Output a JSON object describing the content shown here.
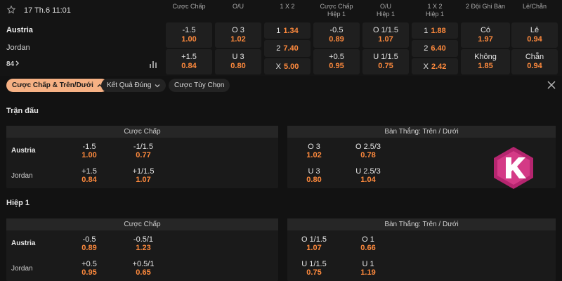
{
  "match": {
    "datetime": "17 Th.6 11:01",
    "team_home": "Austria",
    "team_away": "Jordan",
    "more_markets": "84"
  },
  "columns": [
    {
      "line1": "Cược Chấp",
      "line2": ""
    },
    {
      "line1": "O/U",
      "line2": ""
    },
    {
      "line1": "1 X 2",
      "line2": ""
    },
    {
      "line1": "Cược Chấp",
      "line2": "Hiệp 1"
    },
    {
      "line1": "O/U",
      "line2": "Hiệp 1"
    },
    {
      "line1": "1 X 2",
      "line2": "Hiệp 1"
    },
    {
      "line1": "2 Đội Ghi Bàn",
      "line2": ""
    },
    {
      "line1": "Lẻ/Chẵn",
      "line2": ""
    }
  ],
  "top_odds": {
    "handicap": [
      {
        "label": "-1.5",
        "value": "1.00"
      },
      {
        "label": "+1.5",
        "value": "0.84"
      }
    ],
    "ou": [
      {
        "label": "O 3",
        "value": "1.02"
      },
      {
        "label": "U 3",
        "value": "0.80"
      }
    ],
    "x12": [
      {
        "label": "1",
        "value": "1.34"
      },
      {
        "label": "2",
        "value": "7.40"
      },
      {
        "label": "X",
        "value": "5.00"
      }
    ],
    "handicap_h1": [
      {
        "label": "-0.5",
        "value": "0.89"
      },
      {
        "label": "+0.5",
        "value": "0.95"
      }
    ],
    "ou_h1": [
      {
        "label": "O 1/1.5",
        "value": "1.07"
      },
      {
        "label": "U 1/1.5",
        "value": "0.75"
      }
    ],
    "x12_h1": [
      {
        "label": "1",
        "value": "1.88"
      },
      {
        "label": "2",
        "value": "6.40"
      },
      {
        "label": "X",
        "value": "2.42"
      }
    ],
    "btts": [
      {
        "label": "Có",
        "value": "1.97"
      },
      {
        "label": "Không",
        "value": "1.85"
      }
    ],
    "oddeven": [
      {
        "label": "Lẻ",
        "value": "0.94"
      },
      {
        "label": "Chẵn",
        "value": "0.94"
      }
    ]
  },
  "tabs": [
    {
      "label": "Cược Chấp & Trên/Dưới",
      "active": true
    },
    {
      "label": "Kết Quả Đúng",
      "active": false
    },
    {
      "label": "Cược Tùy Chọn",
      "active": false
    }
  ],
  "sections": [
    {
      "title": "Trận đấu",
      "handicap_panel": {
        "title": "Cược Chấp",
        "home": "Austria",
        "away": "Jordan",
        "home_odds": [
          {
            "label": "-1.5",
            "value": "1.00"
          },
          {
            "label": "-1/1.5",
            "value": "0.77"
          }
        ],
        "away_odds": [
          {
            "label": "+1.5",
            "value": "0.84"
          },
          {
            "label": "+1/1.5",
            "value": "1.07"
          }
        ]
      },
      "ou_panel": {
        "title": "Bàn Thắng: Trên / Dưới",
        "over_odds": [
          {
            "label": "O 3",
            "value": "1.02"
          },
          {
            "label": "O 2.5/3",
            "value": "0.78"
          }
        ],
        "under_odds": [
          {
            "label": "U 3",
            "value": "0.80"
          },
          {
            "label": "U 2.5/3",
            "value": "1.04"
          }
        ]
      }
    },
    {
      "title": "Hiệp 1",
      "handicap_panel": {
        "title": "Cược Chấp",
        "home": "Austria",
        "away": "Jordan",
        "home_odds": [
          {
            "label": "-0.5",
            "value": "0.89"
          },
          {
            "label": "-0.5/1",
            "value": "1.23"
          }
        ],
        "away_odds": [
          {
            "label": "+0.5",
            "value": "0.95"
          },
          {
            "label": "+0.5/1",
            "value": "0.65"
          }
        ]
      },
      "ou_panel": {
        "title": "Bàn Thắng: Trên / Dưới",
        "over_odds": [
          {
            "label": "O 1/1.5",
            "value": "1.07"
          },
          {
            "label": "O 1",
            "value": "0.66"
          }
        ],
        "under_odds": [
          {
            "label": "U 1/1.5",
            "value": "0.75"
          },
          {
            "label": "U 1",
            "value": "1.19"
          }
        ]
      }
    }
  ],
  "colors": {
    "accent": "#ff8a3d",
    "active_tab": "#f6b184",
    "logo": "#b5256f"
  },
  "icons": [
    "star-icon",
    "stats-icon",
    "chevron-right-icon",
    "chevron-up-icon",
    "chevron-down-icon",
    "close-icon",
    "brand-logo-icon"
  ]
}
